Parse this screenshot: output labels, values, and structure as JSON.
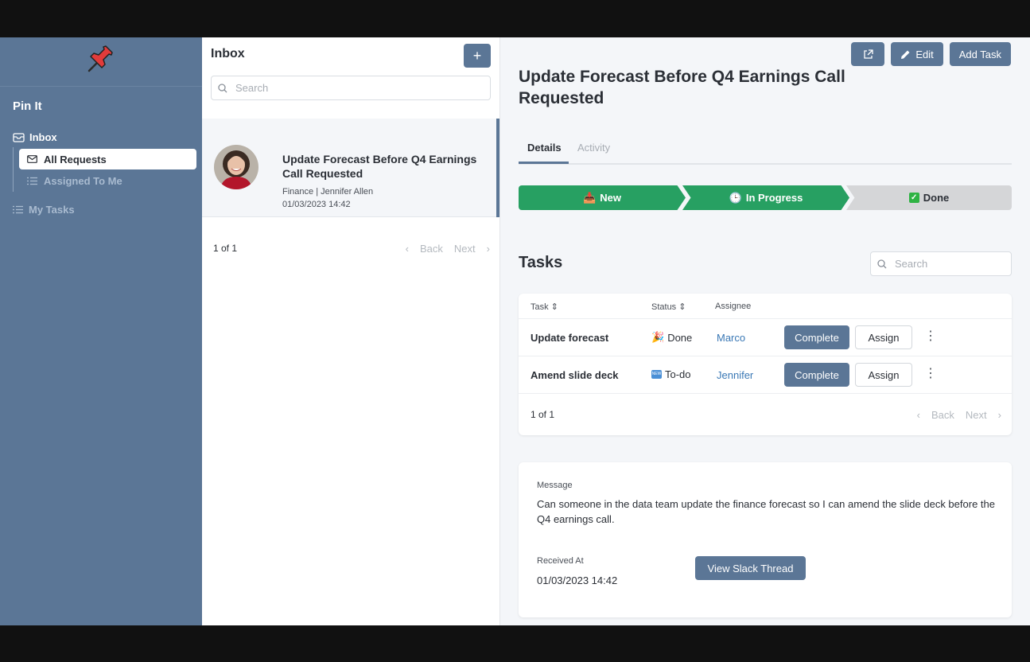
{
  "sidebar": {
    "app_name": "Pin It",
    "items": [
      {
        "label": "Inbox",
        "icon": "inbox-icon"
      },
      {
        "label": "All Requests",
        "icon": "envelope-icon"
      },
      {
        "label": "Assigned To Me",
        "icon": "list-icon"
      },
      {
        "label": "My Tasks",
        "icon": "list-icon"
      }
    ],
    "logo_icon": "pushpin-icon"
  },
  "inbox": {
    "title": "Inbox",
    "add_label": "+",
    "search_placeholder": "Search",
    "items": [
      {
        "title": "Update Forecast Before Q4 Earnings Call Requested",
        "meta": "Finance | Jennifer Allen",
        "date": "01/03/2023 14:42"
      }
    ],
    "pager": {
      "count": "1 of 1",
      "back": "Back",
      "next": "Next"
    }
  },
  "detail": {
    "actions": {
      "open_icon": "external-link-icon",
      "edit": "Edit",
      "add_task": "Add Task"
    },
    "title": "Update Forecast Before Q4 Earnings Call Requested",
    "tabs": [
      "Details",
      "Activity"
    ],
    "steps": [
      {
        "label": "New",
        "icon": "inbox-tray-emoji"
      },
      {
        "label": "In Progress",
        "icon": "clock-emoji"
      },
      {
        "label": "Done",
        "icon": "check-mark-emoji"
      }
    ]
  },
  "tasks": {
    "title": "Tasks",
    "search_placeholder": "Search",
    "columns": [
      "Task ⇕",
      "Status ⇕",
      "Assignee"
    ],
    "rows": [
      {
        "task": "Update forecast",
        "status": "Done",
        "status_icon": "party-popper-emoji",
        "assignee": "Marco",
        "complete": "Complete",
        "assign": "Assign"
      },
      {
        "task": "Amend slide deck",
        "status": "To-do",
        "status_icon": "new-emoji",
        "assignee": "Jennifer",
        "complete": "Complete",
        "assign": "Assign"
      }
    ],
    "pager": {
      "count": "1 of 1",
      "back": "Back",
      "next": "Next"
    }
  },
  "message": {
    "label": "Message",
    "text": "Can someone in the data team update the finance forecast so I can amend the slide deck before the Q4 earnings call.",
    "received_label": "Received At",
    "received_value": "01/03/2023 14:42",
    "slack_button": "View Slack Thread"
  },
  "colors": {
    "accent": "#5b7696",
    "success": "#27a062",
    "link": "#3a78b5",
    "background": "#f4f6f9"
  }
}
